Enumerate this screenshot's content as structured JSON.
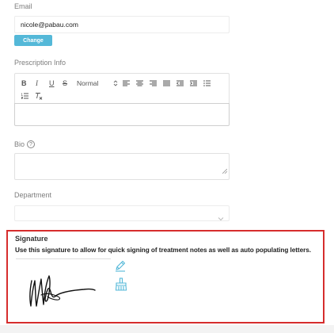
{
  "email": {
    "label": "Email",
    "value": "nicole@pabau.com",
    "change_label": "Change"
  },
  "prescription": {
    "label": "Prescription Info",
    "toolbar": {
      "bold": "B",
      "italic": "I",
      "underline": "U",
      "strike": "S",
      "format_select": "Normal"
    },
    "value": ""
  },
  "bio": {
    "label": "Bio",
    "help_glyph": "?",
    "value": ""
  },
  "department": {
    "label": "Department",
    "selected": ""
  },
  "signature": {
    "title": "Signature",
    "description": "Use this signature to allow for quick signing of treatment notes as well as auto populating letters.",
    "edit_icon": "pencil-icon",
    "clear_icon": "broom-icon"
  },
  "colors": {
    "accent": "#54b8d8",
    "highlight_border": "#d62d2d"
  }
}
